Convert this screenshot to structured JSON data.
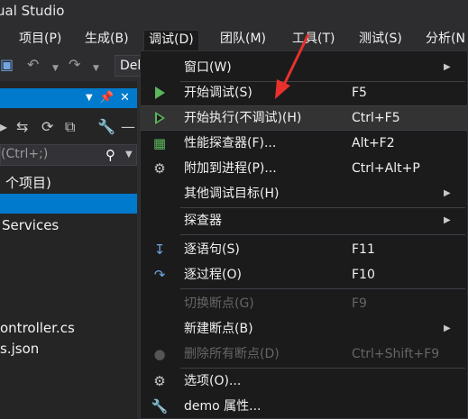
{
  "window": {
    "title": "ual Studio"
  },
  "menubar": {
    "items": [
      {
        "label": "项目(P)"
      },
      {
        "label": "生成(B)"
      },
      {
        "label": "调试(D)"
      },
      {
        "label": "团队(M)"
      },
      {
        "label": "工具(T)"
      },
      {
        "label": "测试(S)"
      },
      {
        "label": "分析(N"
      }
    ]
  },
  "toolbar": {
    "config_combo": "Del",
    "icons": [
      "save-icon",
      "undo-icon",
      "redo-icon"
    ]
  },
  "solution_explorer": {
    "search_placeholder": "(Ctrl+;)",
    "tree": [
      {
        "label": "个项目)"
      },
      {
        "label": ""
      },
      {
        "label": "Services"
      },
      {
        "label": "ontroller.cs"
      },
      {
        "label": "s.json"
      }
    ]
  },
  "debug_menu": {
    "items": [
      {
        "label": "窗口(W)",
        "shortcut": "",
        "submenu": true,
        "icon": "",
        "enabled": true
      },
      {
        "label": "开始调试(S)",
        "shortcut": "F5",
        "submenu": false,
        "icon": "play-icon",
        "enabled": true
      },
      {
        "label": "开始执行(不调试)(H)",
        "shortcut": "Ctrl+F5",
        "submenu": false,
        "icon": "play-outline-icon",
        "enabled": true,
        "highlighted": true
      },
      {
        "label": "性能探查器(F)...",
        "shortcut": "Alt+F2",
        "submenu": false,
        "icon": "performance-icon",
        "enabled": true
      },
      {
        "label": "附加到进程(P)...",
        "shortcut": "Ctrl+Alt+P",
        "submenu": false,
        "icon": "attach-process-icon",
        "enabled": true
      },
      {
        "label": "其他调试目标(H)",
        "shortcut": "",
        "submenu": true,
        "icon": "",
        "enabled": true
      },
      {
        "label": "探查器",
        "shortcut": "",
        "submenu": true,
        "icon": "",
        "enabled": true
      },
      {
        "label": "逐语句(S)",
        "shortcut": "F11",
        "submenu": false,
        "icon": "step-into-icon",
        "enabled": true
      },
      {
        "label": "逐过程(O)",
        "shortcut": "F10",
        "submenu": false,
        "icon": "step-over-icon",
        "enabled": true
      },
      {
        "label": "切换断点(G)",
        "shortcut": "F9",
        "submenu": false,
        "icon": "",
        "enabled": false
      },
      {
        "label": "新建断点(B)",
        "shortcut": "",
        "submenu": true,
        "icon": "",
        "enabled": true
      },
      {
        "label": "删除所有断点(D)",
        "shortcut": "Ctrl+Shift+F9",
        "submenu": false,
        "icon": "delete-breakpoints-icon",
        "enabled": false
      },
      {
        "label": "选项(O)...",
        "shortcut": "",
        "submenu": false,
        "icon": "gear-icon",
        "enabled": true
      },
      {
        "label": "demo 属性...",
        "shortcut": "",
        "submenu": false,
        "icon": "wrench-icon",
        "enabled": true
      }
    ]
  },
  "colors": {
    "accent": "#007acc",
    "menu_bg": "#1b1b1c",
    "annotation_arrow": "#e8312c",
    "play_green": "#5bb75b"
  }
}
